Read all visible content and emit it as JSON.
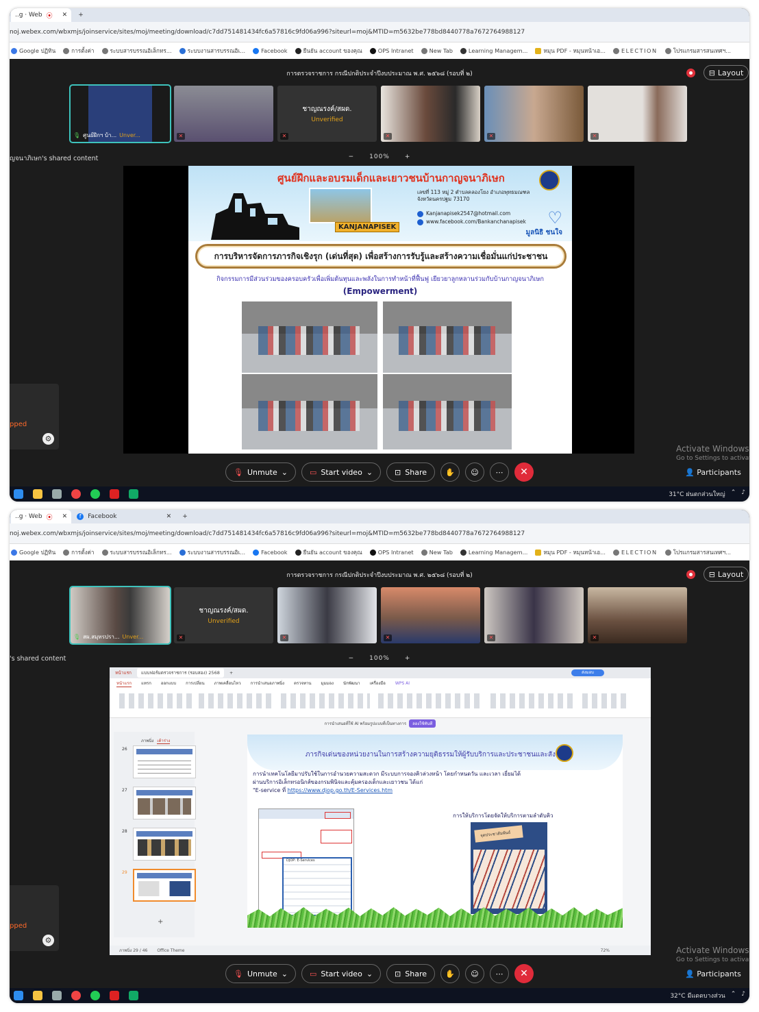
{
  "browser": {
    "tab1_title": "..g · Web",
    "tab2_title": "Facebook",
    "new_tab": "+",
    "url": "noj.webex.com/wbxmjs/joinservice/sites/moj/meeting/download/c7dd751481434fc6a57816c9fd06a996?siteurl=moj&MTID=m5632be778bd8440778a7672764988127",
    "bookmarks": [
      "Google ปฏิทิน",
      "การตั้งค่า",
      "ระบบสารบรรณอิเล็กทร...",
      "ระบบงานสารบรรณอิเ...",
      "Facebook",
      "ยืนยัน account ของคุณ",
      "OPS Intranet",
      "New Tab",
      "Learning Managem...",
      "หมุน PDF - หมุนหน้าเอ...",
      "ELECTION",
      "โปรแกรมสารสนเทศฯ..."
    ]
  },
  "meeting": {
    "title": "การตรวจราชการ กรณีปกติประจำปีงบประมาณ พ.ศ. ๒๕๖๘ (รอบที่ ๒)",
    "layout_label": "Layout",
    "zoom": "100%",
    "zoom_minus": "−",
    "zoom_plus": "+",
    "stopped_text": "pped",
    "activate_title": "Activate Windows",
    "activate_sub": "Go to Settings to activat",
    "participants_label": "Participants",
    "controls": {
      "unmute": "Unmute",
      "start_video": "Start video",
      "share": "Share"
    }
  },
  "shot1": {
    "shared_label": "ญจนาภิเษก's shared content",
    "tiles": [
      {
        "name": "ศูนย์ฝึกฯ บ้า...",
        "unverified": "Unver..."
      },
      {
        "name": "",
        "unverified": ""
      },
      {
        "name": "ชาญณรงค์/สผด.",
        "unverified": "Unverified"
      },
      {
        "name": "",
        "unverified": ""
      },
      {
        "name": "",
        "unverified": ""
      },
      {
        "name": "",
        "unverified": ""
      }
    ],
    "tray_text": "31°C ฝนตกส่วนใหญ่",
    "slide": {
      "title": "ศูนย์ฝึกและอบรมเด็กและเยาวชนบ้านกาญจนาภิเษก",
      "kanja": "KANJANAPISEK",
      "addr1": "เลขที่ 113 หมู่ 2 ตำบลคลองโยง อำเภอพุทธมณฑล",
      "addr2": "จังหวัดนครปฐม 73170",
      "email": "Kanjanapisek2547@hotmail.com",
      "fb": "www.facebook.com/Bankanchanapisek",
      "foundation": "มูลนิธิ ชนใจ",
      "banner": "การบริหารจัดการภารกิจเชิงรุก (เด่นที่สุด) เพื่อสร้างการรับรู้และสร้างความเชื่อมั่นแก่ประชาชน",
      "subtitle": "กิจกรรมการมีส่วนร่วมของครอบครัวเพื่อเพิ่มต้นทุนและพลังในการทำหน้าที่ฟื้นฟู เยียวยาลูกหลานร่วมกับบ้านกาญจนาภิเษก",
      "emphasis": "(Empowerment)"
    }
  },
  "shot2": {
    "shared_label": "'s shared content",
    "tiles": [
      {
        "name": "สผ.สมุทรปรา...",
        "unverified": "Unver..."
      },
      {
        "name": "ชาญณรงค์/สผด.",
        "unverified": "Unverified"
      },
      {
        "name": "",
        "unverified": ""
      },
      {
        "name": "",
        "unverified": ""
      },
      {
        "name": "",
        "unverified": ""
      },
      {
        "name": "",
        "unverified": ""
      }
    ],
    "tray_text": "32°C มีแดดบางส่วน",
    "wps": {
      "app_tab": "หน้าแรก",
      "doc_tab": "แบบฟอร์มตรวจราชการ (รอบสอง) 2568",
      "menu": [
        "หน้าแรก",
        "แทรก",
        "ออกแบบ",
        "การเปลี่ยน",
        "ภาพเคลื่อนไหว",
        "การนำเสนอภาพนิ่ง",
        "ตรวจทาน",
        "มุมมอง",
        "นักพัฒนา",
        "เครื่องมือ",
        "WPS AI"
      ],
      "ai_text": "การนำเสนอที่ใช้ AI พร้อมรูปแบบที่เป็นทางการ",
      "ai_button": "ลองใช้ทันที",
      "thumb_header": "ภาพนิ่ง",
      "thumb_tab": "เค้าร่าง",
      "thumb_numbers": [
        "26",
        "27",
        "28",
        "29"
      ],
      "status_slide": "ภาพนิ่ง 29 / 46",
      "status_theme": "Office Theme",
      "status_zoom": "72%",
      "share_btn": "ส่งมอบ"
    },
    "slide": {
      "title": "ภารกิจเด่นของหน่วยงานในการสร้างความยุติธรรมให้ผู้รับบริการและประชาชนและสังคม",
      "para1": "การนำเทคโนโลยีมาปรับใช้ในการอำนวยความสะดวก มีระบบการจองคิวล่วงหน้า โดยกำหนดวัน และเวลา เยี่ยมได้",
      "para2": "ผ่านบริการอิเล็กทรอนิกส์ของกรมพินิจและคุ้มครองเด็กและเยาวชน ได้แก่",
      "para3_prefix": "\"E-service ที่ ",
      "link": "https://www.djop.go.th/E-Services.htm",
      "screenshot_label": "DJOP: E-Services",
      "caption": "การให้บริการโดยจัดให้บริการตามลำดับคิว",
      "photo_label": "จุดประชาสัมพันธ์"
    }
  }
}
